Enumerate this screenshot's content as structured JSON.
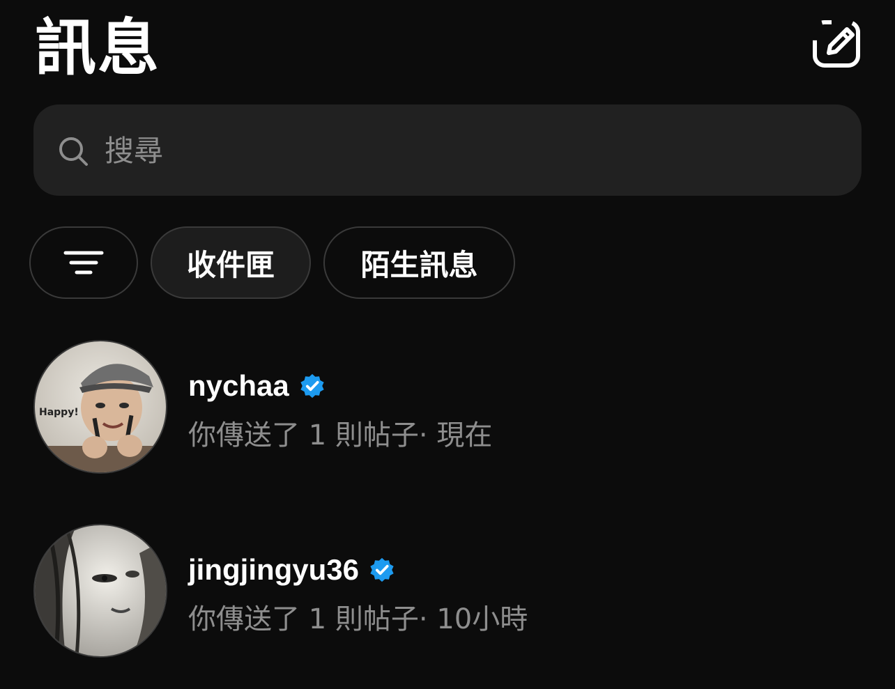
{
  "header": {
    "title": "訊息",
    "compose_icon": "edit-square-icon"
  },
  "search": {
    "placeholder": "搜尋",
    "value": "",
    "icon": "search-icon"
  },
  "filters": {
    "filter_icon": "filter-lines-icon",
    "chips": [
      {
        "label": "收件匣",
        "selected": true
      },
      {
        "label": "陌生訊息",
        "selected": false
      }
    ]
  },
  "conversations": [
    {
      "username": "nychaa",
      "verified": true,
      "avatar_caption": "Happy!",
      "last_message": "你傳送了 1 則帖子",
      "time": "現在"
    },
    {
      "username": "jingjingyu36",
      "verified": true,
      "last_message": "你傳送了 1 則帖子",
      "time": "10小時"
    }
  ],
  "colors": {
    "background": "#0c0c0c",
    "search_bg": "#212121",
    "muted_text": "#8e8e8e",
    "verified_blue": "#1d9bf0"
  }
}
